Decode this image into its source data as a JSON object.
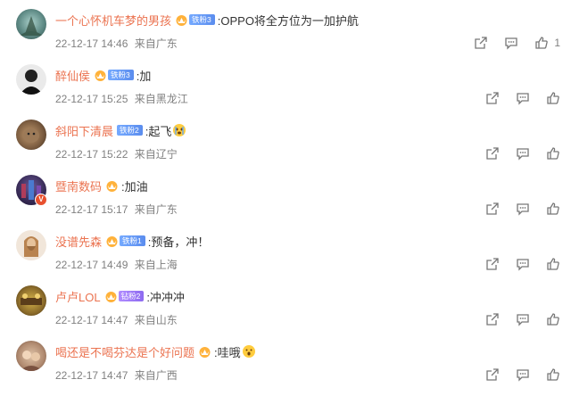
{
  "comments": [
    {
      "username": "一个心怀机车梦的男孩",
      "badge": "铁粉3",
      "badge_color": "blue",
      "text": ":OPPO将全方位为一加护航",
      "date": "22-12-17 14:46",
      "location": "来自广东",
      "likes": "1",
      "avatar_color": "#5f8b86"
    },
    {
      "username": "醉仙侯",
      "badge": "铁粉3",
      "badge_color": "blue",
      "text": ":加",
      "date": "22-12-17 15:25",
      "location": "来自黑龙江",
      "likes": "",
      "avatar_color": "#2a2a2a"
    },
    {
      "username": "斜阳下清晨",
      "badge": "铁粉2",
      "badge_color": "blue",
      "text": ":起飞",
      "date": "22-12-17 15:22",
      "location": "来自辽宁",
      "likes": "",
      "avatar_color": "#7a5b3f"
    },
    {
      "username": "暨南数码",
      "badge": "",
      "badge_color": "",
      "text": ":加油",
      "date": "22-12-17 15:17",
      "location": "来自广东",
      "likes": "",
      "avatar_color": "#3b2e5a"
    },
    {
      "username": "没谱先森",
      "badge": "铁粉1",
      "badge_color": "blue",
      "text": ":预备，冲！",
      "date": "22-12-17 14:49",
      "location": "来自上海",
      "likes": "",
      "avatar_color": "#c9a27a"
    },
    {
      "username": "卢卢LOL",
      "badge": "钻粉2",
      "badge_color": "purple",
      "text": ":冲冲冲",
      "date": "22-12-17 14:47",
      "location": "来自山东",
      "likes": "",
      "avatar_color": "#8b6b2a"
    },
    {
      "username": "喝还是不喝芬达是个好问题",
      "badge": "",
      "badge_color": "",
      "text": ":哇哦",
      "date": "22-12-17 14:47",
      "location": "来自广西",
      "likes": "",
      "avatar_color": "#b08a70"
    }
  ],
  "icons": {
    "share": "share-icon",
    "comment": "comment-icon",
    "like": "thumbs-up-icon"
  }
}
